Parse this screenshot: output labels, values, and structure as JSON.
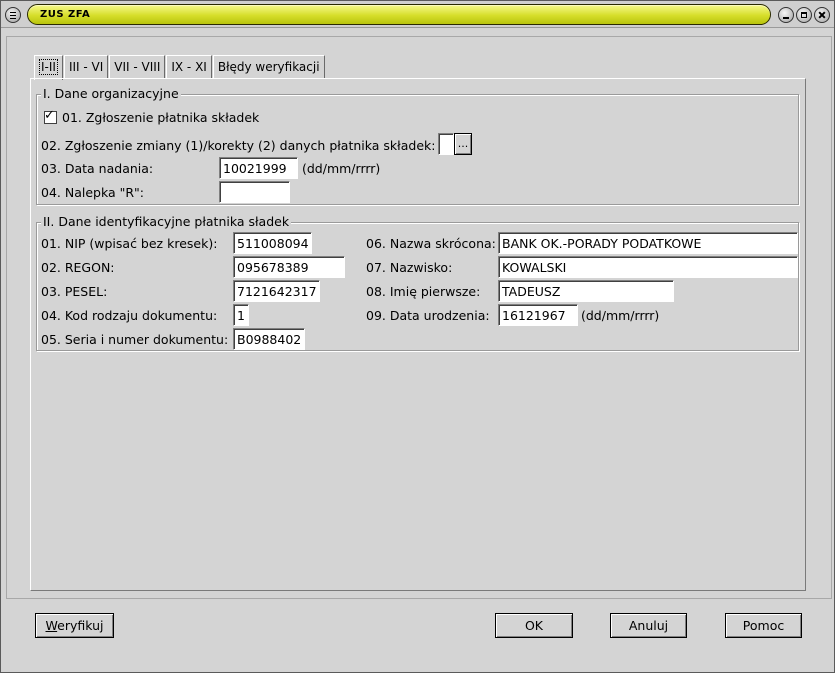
{
  "window": {
    "title": "ZUS ZFA"
  },
  "tabs": [
    "I-II",
    "III - VI",
    "VII - VIII",
    "IX - XI",
    "Błędy weryfikacji"
  ],
  "section1": {
    "title": "I. Dane organizacyjne",
    "item01": {
      "label": "01. Zgłoszenie płatnika składek",
      "checked": true
    },
    "item02": {
      "label": "02. Zgłoszenie zmiany (1)/korekty (2) danych płatnika składek:",
      "value": "",
      "browse": "..."
    },
    "item03": {
      "label": "03. Data nadania:",
      "value": "10021999",
      "hint": "(dd/mm/rrrr)"
    },
    "item04": {
      "label": "04. Nalepka \"R\":",
      "value": ""
    }
  },
  "section2": {
    "title": "II. Dane identyfikacyjne płatnika sładek",
    "nip": {
      "label": "01. NIP (wpisać bez kresek):",
      "value": "511008094"
    },
    "regon": {
      "label": "02. REGON:",
      "value": "095678389"
    },
    "pesel": {
      "label": "03. PESEL:",
      "value": "7121642317"
    },
    "kod": {
      "label": "04. Kod rodzaju dokumentu:",
      "value": "1"
    },
    "seria": {
      "label": "05. Seria i numer dokumentu:",
      "value": "B0988402"
    },
    "nazwa": {
      "label": "06. Nazwa skrócona:",
      "value": "BANK OK.-PORADY PODATKOWE"
    },
    "nazwisko": {
      "label": "07. Nazwisko:",
      "value": "KOWALSKI"
    },
    "imie": {
      "label": "08. Imię pierwsze:",
      "value": "TADEUSZ"
    },
    "data_ur": {
      "label": "09. Data urodzenia:",
      "value": "16121967",
      "hint": "(dd/mm/rrrr)"
    }
  },
  "buttons": {
    "weryfikuj_first": "W",
    "weryfikuj_rest": "eryfikuj",
    "ok": "OK",
    "anuluj": "Anuluj",
    "pomoc": "Pomoc"
  },
  "icons": {
    "window_menu": "menu-icon",
    "minimize": "minimize-icon",
    "maximize": "maximize-icon",
    "close": "close-icon"
  },
  "colors": {
    "title_bar": "#d6de2a",
    "background": "#d4d4d4"
  }
}
